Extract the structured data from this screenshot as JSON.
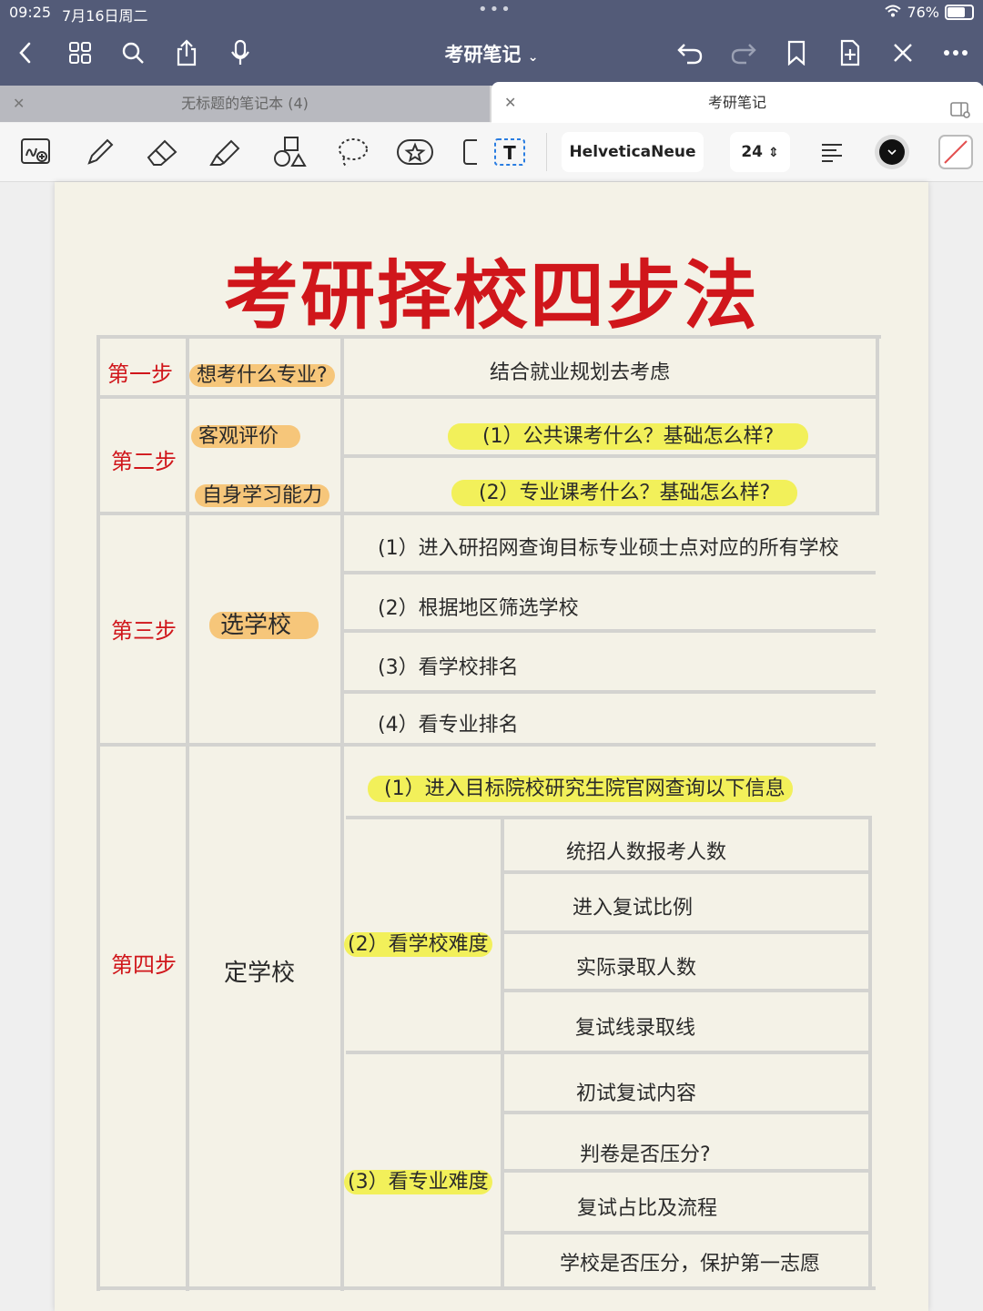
{
  "status": {
    "time": "09:25",
    "date": "7月16日周二",
    "battery": "76%"
  },
  "nav": {
    "title": "考研笔记"
  },
  "tabs": [
    {
      "label": "无标题的笔记本 (4)",
      "active": false
    },
    {
      "label": "考研笔记",
      "active": true
    }
  ],
  "toolbar": {
    "font": "HelveticaNeue",
    "size": "24"
  },
  "note": {
    "title": "考研择校四步法",
    "step1": {
      "label": "第一步",
      "question": "想考什么专业?",
      "detail": "结合就业规划去考虑"
    },
    "step2": {
      "label": "第二步",
      "q1": "客观评价",
      "q2": "自身学习能力",
      "items": [
        "(1）公共课考什么？基础怎么样?",
        "(2）专业课考什么？基础怎么样?"
      ]
    },
    "step3": {
      "label": "第三步",
      "question": "选学校",
      "items": [
        "(1）进入研招网查询目标专业硕士点对应的所有学校",
        "(2）根据地区筛选学校",
        "(3）看学校排名",
        "(4）看专业排名"
      ]
    },
    "step4": {
      "label": "第四步",
      "question": "定学校",
      "item1": "(1）进入目标院校研究生院官网查询以下信息",
      "sub2": "(2）看学校难度",
      "sub2_items": [
        "统招人数报考人数",
        "进入复试比例",
        "实际录取人数",
        "复试线录取线"
      ],
      "sub3": "(3）看专业难度",
      "sub3_items": [
        "初试复试内容",
        "判卷是否压分?",
        "复试占比及流程",
        "学校是否压分，保护第一志愿"
      ]
    }
  },
  "colors": {
    "title_red": "#d0161b",
    "highlight_orange": "#f6c67a",
    "highlight_yellow": "#f2f05a",
    "nav_bg": "#535b78"
  }
}
